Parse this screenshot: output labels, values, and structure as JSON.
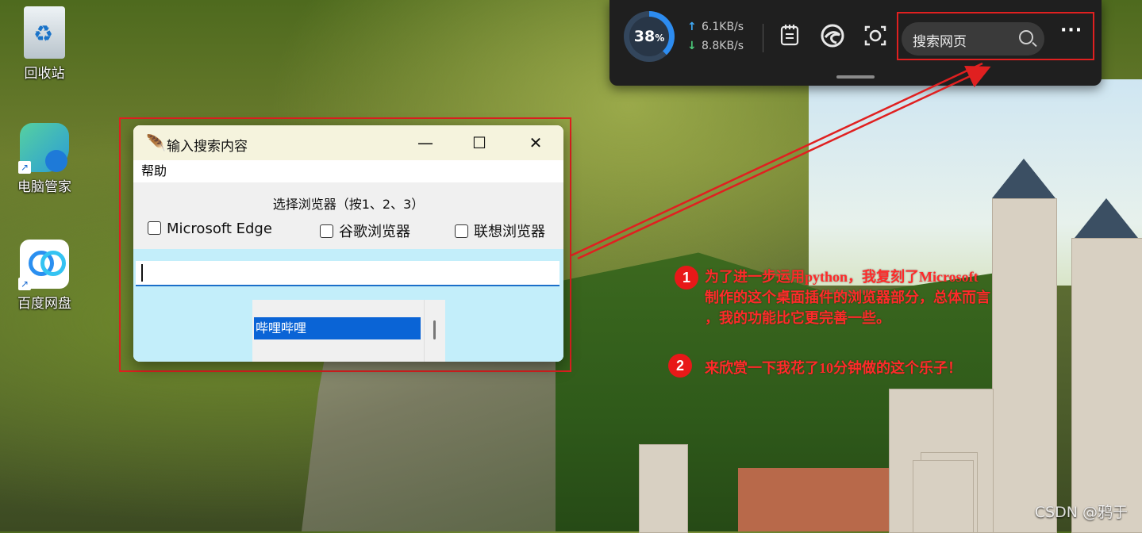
{
  "desktop": {
    "icons": [
      {
        "label": "回收站",
        "icon": "recycle-bin-icon"
      },
      {
        "label": "电脑管家",
        "icon": "pc-manager-icon"
      },
      {
        "label": "百度网盘",
        "icon": "baidu-netdisk-icon"
      }
    ]
  },
  "widget": {
    "gauge_value": "38",
    "gauge_unit": "%",
    "upload_arrow": "↑",
    "upload_speed": "6.1KB/s",
    "download_arrow": "↓",
    "download_speed": "8.8KB/s",
    "search_text": "搜索网页",
    "more_label": "···",
    "buttons": [
      "notes-icon",
      "edge-icon",
      "screenshot-icon"
    ]
  },
  "window": {
    "title": "输入搜索内容",
    "menu": "帮助",
    "choose_label": "选择浏览器（按1、2、3）",
    "checkboxes": [
      "Microsoft Edge",
      "谷歌浏览器",
      "联想浏览器"
    ],
    "entry_value": "",
    "list_items": [
      "哔哩哔哩"
    ],
    "minimize": "—",
    "maximize": "☐",
    "close": "✕"
  },
  "annotations": {
    "n1": "1",
    "line1": "为了进一步运用python，我复刻了Microsoft",
    "line2": "制作的这个桌面插件的浏览器部分，总体而言",
    "line3": "，我的功能比它更完善一些。",
    "n2": "2",
    "line4": "来欣赏一下我花了10分钟做的这个乐子！"
  },
  "watermark": "CSDN @鸦于",
  "colors": {
    "annotation": "#e02020",
    "accent": "#2d8cf0",
    "selection": "#0a64d6"
  }
}
